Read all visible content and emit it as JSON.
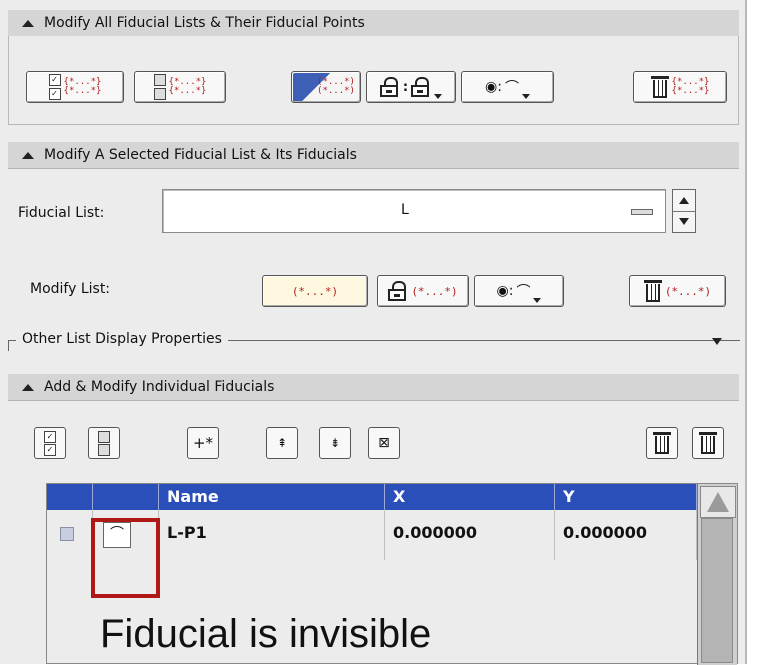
{
  "sections": {
    "all_lists": {
      "title": "Modify All Fiducial Lists & Their Fiducial Points"
    },
    "selected_list": {
      "title": "Modify A Selected Fiducial List & Its Fiducials",
      "fiducial_list_label": "Fiducial List:",
      "fiducial_list_value": "L",
      "modify_list_label": "Modify List:",
      "other_display": "Other List Display Properties"
    },
    "individual": {
      "title": "Add & Modify Individual Fiducials"
    }
  },
  "icon_text": {
    "pair": "{*...*}",
    "pair_short": "(*...*)",
    "plus": "+*",
    "eye_colon": "◉:"
  },
  "table": {
    "columns": [
      "",
      "",
      "Name",
      "X",
      "Y"
    ],
    "rows": [
      {
        "name": "L-P1",
        "x": "0.000000",
        "y": "0.000000"
      }
    ]
  },
  "annotation": "Fiducial is invisible",
  "colors": {
    "header_blue": "#2b4fb8",
    "highlight_red": "#b01818",
    "pair_red": "#b02020"
  }
}
